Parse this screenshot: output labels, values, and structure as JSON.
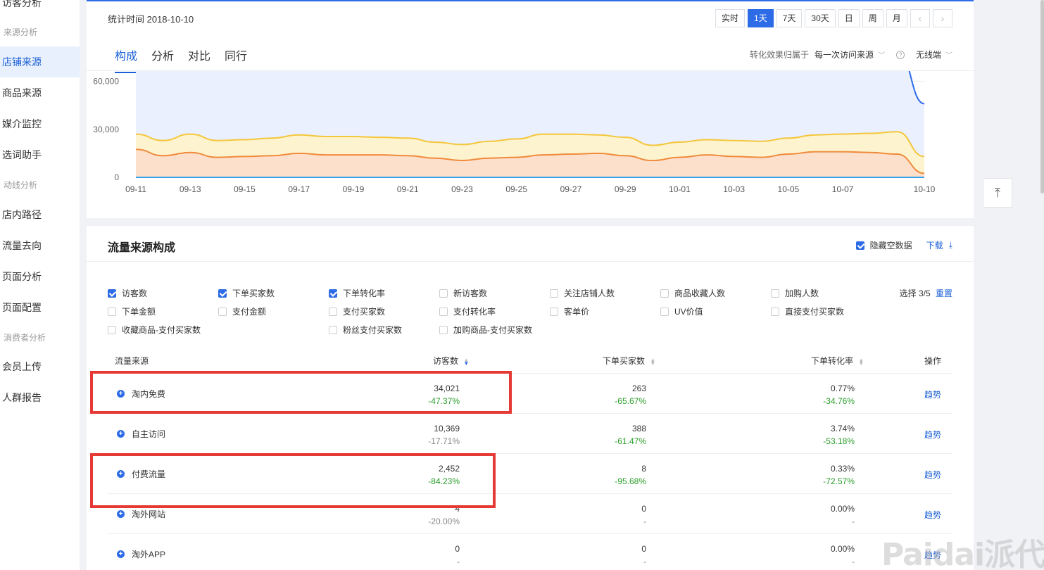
{
  "sidebar": {
    "top_partial": "访客分析",
    "groups": [
      "来源分析",
      "动线分析",
      "消费者分析"
    ],
    "items": [
      "店铺来源",
      "商品来源",
      "媒介监控",
      "选词助手",
      "店内路径",
      "流量去向",
      "页面分析",
      "页面配置",
      "会员上传",
      "人群报告"
    ]
  },
  "header": {
    "stat_time": "统计时间 2018-10-10",
    "ranges": [
      "实时",
      "1天",
      "7天",
      "30天",
      "日",
      "周",
      "月"
    ],
    "active_range": "1天",
    "prev": "‹",
    "next": "›"
  },
  "tabs": [
    "构成",
    "分析",
    "对比",
    "同行"
  ],
  "attribution": {
    "label": "转化效果归属于",
    "selected": "每一次访问来源",
    "help": "?",
    "device": "无线端"
  },
  "chart_data": {
    "type": "area",
    "x": [
      "09-11",
      "09-12",
      "09-13",
      "09-14",
      "09-15",
      "09-16",
      "09-17",
      "09-18",
      "09-19",
      "09-20",
      "09-21",
      "09-22",
      "09-23",
      "09-24",
      "09-25",
      "09-26",
      "09-27",
      "09-28",
      "09-29",
      "09-30",
      "10-01",
      "10-02",
      "10-03",
      "10-04",
      "10-05",
      "10-06",
      "10-07",
      "10-08",
      "10-09",
      "10-10"
    ],
    "tick_labels": [
      "09-11",
      "09-13",
      "09-15",
      "09-17",
      "09-19",
      "09-21",
      "09-23",
      "09-25",
      "09-27",
      "09-29",
      "10-01",
      "10-03",
      "10-05",
      "10-07",
      "10-10"
    ],
    "y_ticks": [
      "0",
      "30,000",
      "60,000"
    ],
    "ylim": [
      0,
      65000
    ],
    "series": [
      {
        "color": "#2e6be6",
        "fill": "#eaf0fd",
        "values": [
          90000,
          90000,
          90000,
          90000,
          90000,
          90000,
          90000,
          90000,
          90000,
          90000,
          90000,
          90000,
          90000,
          90000,
          90000,
          90000,
          90000,
          90000,
          90000,
          70000,
          68000,
          73000,
          68000,
          72000,
          75000,
          80000,
          80000,
          80000,
          80000,
          46000
        ]
      },
      {
        "color": "#f5c63b",
        "fill": "#fdf4cf",
        "values": [
          27000,
          23000,
          27000,
          23000,
          23500,
          24500,
          26500,
          25500,
          25500,
          25000,
          24500,
          22000,
          20500,
          22500,
          24000,
          27000,
          27000,
          26500,
          25000,
          20000,
          22000,
          23500,
          23000,
          22500,
          24500,
          26500,
          27000,
          27500,
          28500,
          13000
        ]
      },
      {
        "color": "#f08a3c",
        "fill": "#fde0cc",
        "values": [
          17500,
          13500,
          15500,
          12500,
          13000,
          13500,
          15000,
          14000,
          14000,
          14000,
          13500,
          12000,
          10500,
          12000,
          12500,
          14000,
          14500,
          15000,
          13500,
          10500,
          12500,
          14000,
          13000,
          12500,
          14500,
          16000,
          16000,
          15500,
          14500,
          2500
        ]
      }
    ]
  },
  "traffic": {
    "title": "流量来源构成",
    "hide_empty": "隐藏空数据",
    "download": "下载",
    "download_icon": "download-arrow",
    "metrics": [
      {
        "label": "访客数",
        "checked": true
      },
      {
        "label": "下单买家数",
        "checked": true
      },
      {
        "label": "下单转化率",
        "checked": true
      },
      {
        "label": "新访客数",
        "checked": false
      },
      {
        "label": "关注店铺人数",
        "checked": false
      },
      {
        "label": "商品收藏人数",
        "checked": false
      },
      {
        "label": "加购人数",
        "checked": false
      },
      {
        "label": "下单金额",
        "checked": false
      },
      {
        "label": "支付金额",
        "checked": false
      },
      {
        "label": "支付买家数",
        "checked": false
      },
      {
        "label": "支付转化率",
        "checked": false
      },
      {
        "label": "客单价",
        "checked": false
      },
      {
        "label": "UV价值",
        "checked": false
      },
      {
        "label": "直接支付买家数",
        "checked": false
      },
      {
        "label": "收藏商品-支付买家数",
        "checked": false
      },
      {
        "label": "粉丝支付买家数",
        "checked": false
      },
      {
        "label": "加购商品-支付买家数",
        "checked": false
      }
    ],
    "select_count": "选择 3/5",
    "reset": "重置",
    "columns": [
      "流量来源",
      "访客数",
      "下单买家数",
      "下单转化率",
      "操作"
    ],
    "rows": [
      {
        "name": "淘内免费",
        "visitors": "34,021",
        "visitors_delta": "-47.37%",
        "buyers": "263",
        "buyers_delta": "-65.67%",
        "rate": "0.77%",
        "rate_delta": "-34.76%",
        "action": "趋势"
      },
      {
        "name": "自主访问",
        "visitors": "10,369",
        "visitors_delta": "-17.71%",
        "buyers": "388",
        "buyers_delta": "-61.47%",
        "rate": "3.74%",
        "rate_delta": "-53.18%",
        "action": "趋势"
      },
      {
        "name": "付费流量",
        "visitors": "2,452",
        "visitors_delta": "-84.23%",
        "buyers": "8",
        "buyers_delta": "-95.68%",
        "rate": "0.33%",
        "rate_delta": "-72.57%",
        "action": "趋势"
      },
      {
        "name": "淘外网站",
        "visitors": "4",
        "visitors_delta": "-20.00%",
        "buyers": "0",
        "buyers_delta": "-",
        "rate": "0.00%",
        "rate_delta": "-",
        "action": "趋势"
      },
      {
        "name": "淘外APP",
        "visitors": "0",
        "visitors_delta": "-",
        "buyers": "0",
        "buyers_delta": "-",
        "rate": "0.00%",
        "rate_delta": "-",
        "action": "趋势"
      }
    ]
  },
  "colors": {
    "accent": "#2e6be6",
    "positive_delta": "#2a9d2a",
    "highlight": "#e53935"
  },
  "backtop_icon": "⤒",
  "watermark": "Paidai派代"
}
